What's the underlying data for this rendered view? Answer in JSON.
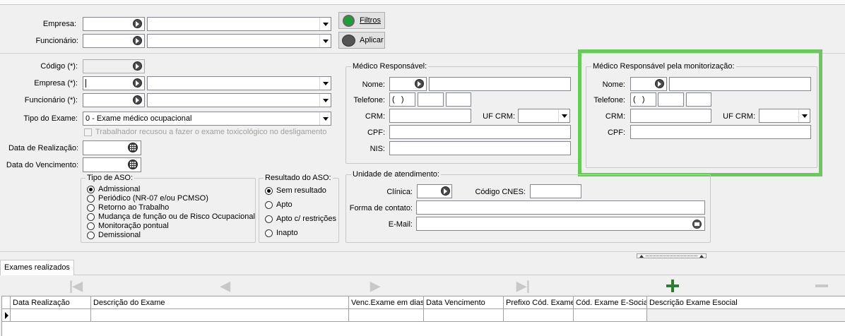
{
  "filter": {
    "empresa_label": "Empresa:",
    "funcionario_label": "Funcionário:",
    "filtros_button": "Filtros",
    "aplicar_button": "Aplicar"
  },
  "form": {
    "codigo_label": "Código (*):",
    "empresa_label": "Empresa (*):",
    "funcionario_label": "Funcionário (*):",
    "tipo_exame_label": "Tipo do Exame:",
    "tipo_exame_value": "0 - Exame médico ocupacional",
    "recusa_label": "Trabalhador recusou a fazer o exame toxicológico no desligamento",
    "data_realizacao_label": "Data de Realização:",
    "data_vencimento_label": "Data do Vencimento:"
  },
  "tipo_aso": {
    "title": "Tipo de ASO:",
    "options": [
      "Admissional",
      "Periódico (NR-07 e/ou PCMSO)",
      "Retorno ao Trabalho",
      "Mudança de função ou de Risco Ocupacional",
      "Monitoração pontual",
      "Demissional"
    ],
    "selected": "Admissional"
  },
  "resultado_aso": {
    "title": "Resultado do ASO:",
    "options": [
      "Sem resultado",
      "Apto",
      "Apto c/ restrições",
      "Inapto"
    ],
    "selected": "Sem resultado"
  },
  "medico": {
    "title": "Médico Responsável:",
    "nome_label": "Nome:",
    "telefone_label": "Telefone:",
    "telefone_mask": "(   )",
    "crm_label": "CRM:",
    "uf_crm_label": "UF CRM:",
    "cpf_label": "CPF:",
    "nis_label": "NIS:"
  },
  "medico_monitor": {
    "title": "Médico Responsável pela monitorização:",
    "nome_label": "Nome:",
    "telefone_label": "Telefone:",
    "telefone_mask": "(   )",
    "crm_label": "CRM:",
    "uf_crm_label": "UF CRM:",
    "cpf_label": "CPF:",
    "highlight_color": "#6ac85d"
  },
  "unidade": {
    "title": "Unidade de atendimento:",
    "clinica_label": "Clínica:",
    "cnes_label": "Código CNES:",
    "forma_contato_label": "Forma de contato:",
    "email_label": "E-Mail:"
  },
  "tabs": [
    {
      "label": "Exames realizados"
    }
  ],
  "grid": {
    "columns": [
      "Data Realização",
      "Descrição do Exame",
      "Venc.Exame em dias",
      "Data Vencimento",
      "Prefixo Cód. Exame",
      "Cód. Exame E-Social",
      "Descrição Exame Esocial"
    ]
  },
  "toolbar": {
    "first_icon": "first-record-icon",
    "prev_icon": "prev-record-icon",
    "next_icon": "next-record-icon",
    "last_icon": "last-record-icon",
    "add_icon": "add-icon",
    "remove_icon": "remove-icon"
  }
}
